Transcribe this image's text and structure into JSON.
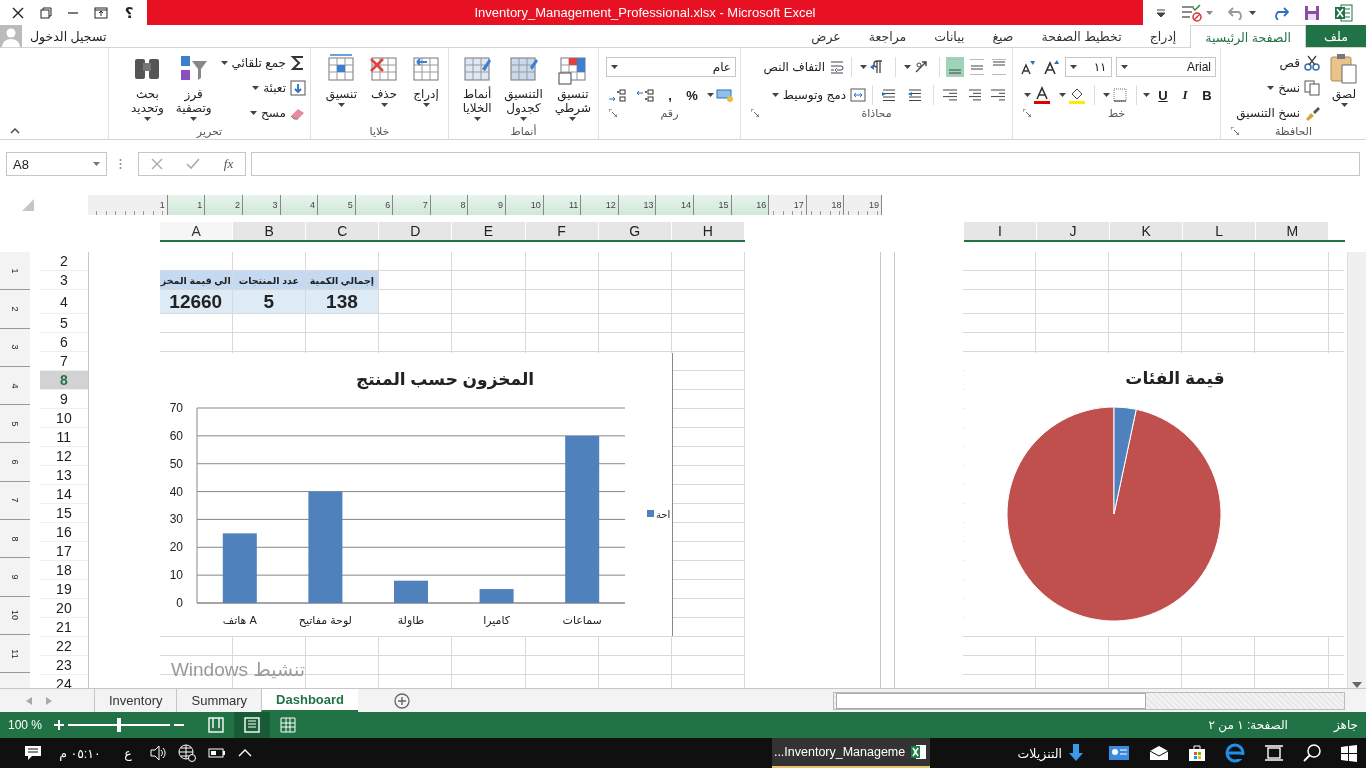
{
  "title_bar": {
    "title": "Inventory_Management_Professional.xlsx -  Microsoft Excel",
    "help": "؟"
  },
  "account": {
    "label": "تسجيل الدخول"
  },
  "ribbon_tabs": [
    {
      "label": "ملف",
      "kind": "file",
      "selected": false
    },
    {
      "label": "الصفحة الرئيسية",
      "kind": "tab",
      "selected": true
    },
    {
      "label": "إدراج",
      "kind": "tab",
      "selected": false
    },
    {
      "label": "تخطيط الصفحة",
      "kind": "tab",
      "selected": false
    },
    {
      "label": "صيغ",
      "kind": "tab",
      "selected": false
    },
    {
      "label": "بيانات",
      "kind": "tab",
      "selected": false
    },
    {
      "label": "مراجعة",
      "kind": "tab",
      "selected": false
    },
    {
      "label": "عرض",
      "kind": "tab",
      "selected": false
    }
  ],
  "ribbon_groups": [
    {
      "kind": "buttons",
      "label": "الحافظة",
      "launcher": true,
      "commands": [
        {
          "label": "لصق",
          "kind": "large",
          "dropdown": true
        },
        {
          "label": "قص",
          "kind": "small"
        },
        {
          "label": "نسخ",
          "kind": "small",
          "dropdown": true
        },
        {
          "label": "نسخ التنسيق",
          "kind": "small"
        }
      ]
    },
    {
      "kind": "font",
      "label": "خط",
      "launcher": true,
      "font": "Arial",
      "size": "١١",
      "styles": [
        "B",
        "I",
        "U"
      ]
    },
    {
      "kind": "alignment",
      "label": "محاذاة",
      "launcher": true,
      "wrap_text": "التفاف النص",
      "merge": "دمج وتوسيط",
      "vertical_align": [
        {
          "selected": false
        },
        {
          "selected": false
        },
        {
          "selected": true
        }
      ]
    },
    {
      "kind": "number",
      "label": "رقم",
      "launcher": true,
      "format": "عام",
      "symbols": [
        "%",
        ","
      ]
    },
    {
      "kind": "buttons",
      "label": "أنماط",
      "commands": [
        {
          "label": "تنسيق\nشرطي",
          "kind": "large",
          "dropdown": true
        },
        {
          "label": "التنسيق\nكجدول",
          "kind": "large",
          "dropdown": true
        },
        {
          "label": "أنماط\nالخلايا",
          "kind": "large",
          "dropdown": true
        }
      ]
    },
    {
      "kind": "buttons",
      "label": "خلايا",
      "commands": [
        {
          "label": "إدراج",
          "kind": "large",
          "dropdown": true
        },
        {
          "label": "حذف",
          "kind": "large",
          "dropdown": true
        },
        {
          "label": "تنسيق",
          "kind": "large",
          "dropdown": true
        }
      ]
    },
    {
      "kind": "buttons",
      "label": "تحرير",
      "commands": [
        {
          "label": "جمع تلقائي",
          "kind": "small",
          "dropdown": true
        },
        {
          "label": "تعبئة",
          "kind": "small",
          "dropdown": true
        },
        {
          "label": "مسح",
          "kind": "small",
          "dropdown": true
        },
        {
          "label": "فرز\nوتصفية",
          "kind": "large",
          "dropdown": true
        },
        {
          "label": "بحث\nوتحديد",
          "kind": "large",
          "dropdown": true
        }
      ]
    }
  ],
  "formula_bar": {
    "name_box": "A8",
    "function_label": "fx"
  },
  "ruler_labels": [
    "19",
    "18",
    "17",
    "16",
    "15",
    "14",
    "13",
    "12",
    "11",
    "10",
    "9",
    "8",
    "7",
    "6",
    "5",
    "4",
    "3",
    "2",
    "1",
    "1"
  ],
  "vertical_ruler_labels": [
    "1",
    "2",
    "3",
    "4",
    "5",
    "6",
    "7",
    "8",
    "9",
    "10",
    "11"
  ],
  "columns_left": [
    {
      "label": "H",
      "selected": false
    },
    {
      "label": "G",
      "selected": false
    },
    {
      "label": "F",
      "selected": false
    },
    {
      "label": "E",
      "selected": false
    },
    {
      "label": "D",
      "selected": false
    },
    {
      "label": "C",
      "selected": false
    },
    {
      "label": "B",
      "selected": false
    },
    {
      "label": "A",
      "selected": true
    }
  ],
  "columns_right": [
    {
      "label": "M",
      "selected": false
    },
    {
      "label": "L",
      "selected": false
    },
    {
      "label": "K",
      "selected": false
    },
    {
      "label": "J",
      "selected": false
    },
    {
      "label": "I",
      "selected": false
    }
  ],
  "rows": [
    {
      "label": "2",
      "selected": false
    },
    {
      "label": "3",
      "selected": false
    },
    {
      "label": "4",
      "selected": false
    },
    {
      "label": "5",
      "selected": false
    },
    {
      "label": "6",
      "selected": false
    },
    {
      "label": "7",
      "selected": false
    },
    {
      "label": "8",
      "selected": true
    },
    {
      "label": "9",
      "selected": false
    },
    {
      "label": "10",
      "selected": false
    },
    {
      "label": "11",
      "selected": false
    },
    {
      "label": "12",
      "selected": false
    },
    {
      "label": "13",
      "selected": false
    },
    {
      "label": "14",
      "selected": false
    },
    {
      "label": "15",
      "selected": false
    },
    {
      "label": "16",
      "selected": false
    },
    {
      "label": "17",
      "selected": false
    },
    {
      "label": "18",
      "selected": false
    },
    {
      "label": "19",
      "selected": false
    },
    {
      "label": "20",
      "selected": false
    },
    {
      "label": "21",
      "selected": false
    },
    {
      "label": "22",
      "selected": false
    },
    {
      "label": "23",
      "selected": false
    },
    {
      "label": "24",
      "selected": false
    }
  ],
  "summary_table": {
    "headers": [
      "إجمالي الكمية",
      "عدد المنتجات",
      "الي قيمة المخز"
    ],
    "values": [
      "138",
      "5",
      "12660"
    ]
  },
  "bar_chart": {
    "chart_data": {
      "type": "bar",
      "title": "المخزون حسب المنتج",
      "categories": [
        "هاتف A",
        "لوحة مفاتيح",
        "طاولة",
        "كاميرا",
        "سماعات"
      ],
      "series": [
        {
          "name": "احة",
          "color": "#4f81bd",
          "values": [
            25,
            40,
            8,
            5,
            60
          ]
        }
      ],
      "ylim": [
        0,
        70
      ],
      "yticks": [
        0,
        10,
        20,
        30,
        40,
        50,
        60,
        70
      ],
      "grid": true
    }
  },
  "pie_chart": {
    "title": "قيمة الفئات"
  },
  "activation_notice": {
    "title": "تنشيط Windows"
  },
  "sheet_tabs": [
    {
      "label": "Dashboard",
      "selected": true
    },
    {
      "label": "Summary",
      "selected": false
    },
    {
      "label": "Inventory",
      "selected": false
    }
  ],
  "status_bar": {
    "ready": "جاهز",
    "page": "الصفحة: ١ من ٢",
    "zoom": "100 %",
    "zoom_slider": {
      "level": 0.5
    },
    "views": [
      {
        "selected": false
      },
      {
        "selected": true
      },
      {
        "selected": false
      }
    ]
  },
  "taskbar": {
    "task": "Inventory_Manageme...",
    "downloads": "التنزيلات",
    "time": "٠٥:١٠ م",
    "language": "ع"
  }
}
